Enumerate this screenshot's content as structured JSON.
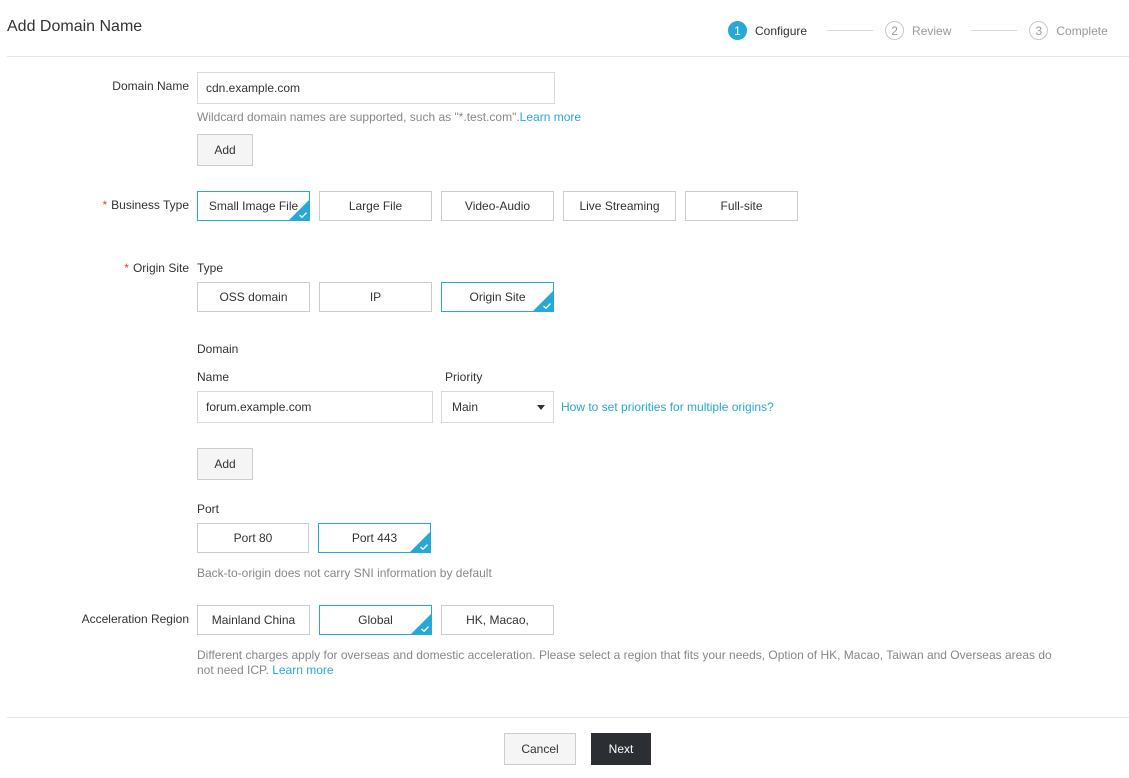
{
  "page_title": "Add Domain Name",
  "steps": [
    {
      "num": "1",
      "label": "Configure"
    },
    {
      "num": "2",
      "label": "Review"
    },
    {
      "num": "3",
      "label": "Complete"
    }
  ],
  "domain_name": {
    "label": "Domain Name",
    "value": "cdn.example.com",
    "hint": "Wildcard domain names are supported, such as \"*.test.com\".",
    "hint_link": "Learn more",
    "add_label": "Add"
  },
  "business_type": {
    "label": "Business Type",
    "required_mark": "*",
    "options": [
      "Small Image File",
      "Large File",
      "Video-Audio",
      "Live Streaming",
      "Full-site"
    ],
    "selected": "Small Image File"
  },
  "origin_site": {
    "label": "Origin Site",
    "required_mark": "*",
    "type_label": "Type",
    "types": [
      "OSS domain",
      "IP",
      "Origin Site"
    ],
    "selected": "Origin Site",
    "domain_label": "Domain",
    "name_label": "Name",
    "priority_label": "Priority",
    "name_value": "forum.example.com",
    "priority_value": "Main",
    "priority_link": "How to set priorities for multiple origins?",
    "add_label": "Add",
    "port_label": "Port",
    "ports": [
      "Port 80",
      "Port 443"
    ],
    "selected_port": "Port 443",
    "port_hint": "Back-to-origin does not carry SNI information by default"
  },
  "acceleration_region": {
    "label": "Acceleration Region",
    "options": [
      "Mainland China",
      "Global",
      "HK, Macao,"
    ],
    "selected": "Global",
    "hint": "Different charges apply for overseas and domestic acceleration. Please select a region that fits your needs, Option of HK, Macao, Taiwan and Overseas areas do not need ICP.",
    "hint_link": "Learn more"
  },
  "footer": {
    "cancel_label": "Cancel",
    "next_label": "Next"
  },
  "colors": {
    "accent": "#26a9d4",
    "required": "#e0481f",
    "primary_button": "#2b2f33"
  }
}
